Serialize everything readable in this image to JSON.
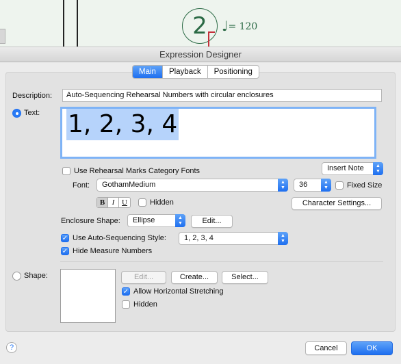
{
  "score": {
    "rehearsal_number": "2",
    "tempo_note": "♩",
    "tempo_text": "= 120"
  },
  "dialog": {
    "title": "Expression Designer",
    "tabs": [
      {
        "label": "Main",
        "active": true
      },
      {
        "label": "Playback",
        "active": false
      },
      {
        "label": "Positioning",
        "active": false
      }
    ]
  },
  "main": {
    "description_label": "Description:",
    "description_value": "Auto-Sequencing Rehearsal Numbers with circular enclosures",
    "text_radio_label": "Text:",
    "text_value": "1, 2, 3, 4",
    "insert_note_label": "Insert Note",
    "use_rehearsal_fonts_label": "Use Rehearsal Marks Category Fonts",
    "font_label": "Font:",
    "font_value": "GothamMedium",
    "size_value": "36",
    "fixed_size_label": "Fixed Size",
    "style_buttons": [
      "B",
      "I",
      "U"
    ],
    "hidden_label": "Hidden",
    "character_settings_label": "Character Settings...",
    "enclosure_label": "Enclosure Shape:",
    "enclosure_value": "Ellipse",
    "edit_label": "Edit...",
    "auto_seq_label": "Use Auto-Sequencing Style:",
    "auto_seq_value": "1, 2, 3, 4",
    "hide_measure_label": "Hide Measure Numbers",
    "shape_radio_label": "Shape:",
    "shape_edit_label": "Edit...",
    "create_label": "Create...",
    "select_label": "Select...",
    "allow_stretch_label": "Allow Horizontal Stretching",
    "shape_hidden_label": "Hidden"
  },
  "footer": {
    "help": "?",
    "cancel": "Cancel",
    "ok": "OK"
  },
  "colors": {
    "accent": "#1e6ff0",
    "rehearsal": "#2b6a45"
  }
}
